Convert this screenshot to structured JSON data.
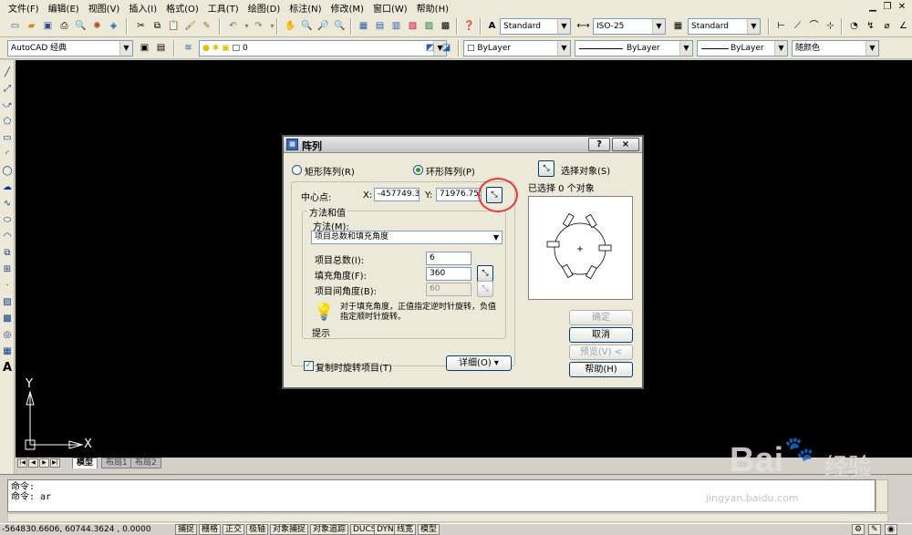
{
  "menu": {
    "items": [
      "文件(F)",
      "编辑(E)",
      "视图(V)",
      "插入(I)",
      "格式(O)",
      "工具(T)",
      "绘图(D)",
      "标注(N)",
      "修改(M)",
      "窗口(W)",
      "帮助(H)"
    ]
  },
  "toolbar": {
    "text_style": "Standard",
    "dim_style": "ISO-25",
    "table_style": "Standard",
    "workspace": "AutoCAD 经典",
    "layer": "0",
    "color": "ByLayer",
    "linetype": "ByLayer",
    "lineweight": "ByLayer",
    "plotstyle": "随颜色"
  },
  "tabs": {
    "model": "模型",
    "layout1": "布局1",
    "layout2": "布局2"
  },
  "command": {
    "line1": "命令:",
    "line2": "命令: ar"
  },
  "status": {
    "coords": "-564830.6606, 60744.3624 , 0.0000",
    "buttons": [
      "捕捉",
      "栅格",
      "正交",
      "极轴",
      "对象捕捉",
      "对象追踪",
      "DUCS",
      "DYN",
      "线宽",
      "模型"
    ]
  },
  "ucs": {
    "x_label": "X",
    "y_label": "Y"
  },
  "dialog": {
    "title": "阵列",
    "help_glyph": "?",
    "close_glyph": "×",
    "rect_label": "矩形阵列(R)",
    "polar_label": "环形阵列(P)",
    "selected_type": "polar",
    "center_label": "中心点:",
    "x_label": "X:",
    "x_value": "-457749.3",
    "y_label": "Y:",
    "y_value": "71976.751",
    "method_group": "方法和值",
    "method_label": "方法(M):",
    "method_value": "项目总数和填充角度",
    "total_label": "项目总数(I):",
    "total_value": "6",
    "fill_label": "填充角度(F):",
    "fill_value": "360",
    "between_label": "项目间角度(B):",
    "between_value": "60",
    "tip_text": "对于填充角度，正值指定逆时针旋转，负值指定顺时针旋转。",
    "tip_label": "提示",
    "rotate_label": "复制时旋转项目(T)",
    "rotate_checked": true,
    "details_label": "详细(O)",
    "details_glyph": "▾",
    "select_label": "选择对象(S)",
    "selected_info": "已选择 0 个对象",
    "ok_label": "确定",
    "cancel_label": "取消",
    "preview_label": "预览(V) <",
    "help_label": "帮助(H)"
  },
  "watermark": {
    "brand": "Bai",
    "brand2": "经验",
    "url": "jingyan.baidu.com"
  },
  "colors": {
    "canvas": "#000000",
    "dialog_bg": "#ece9d8",
    "highlight_circle": "#e23a3a"
  }
}
